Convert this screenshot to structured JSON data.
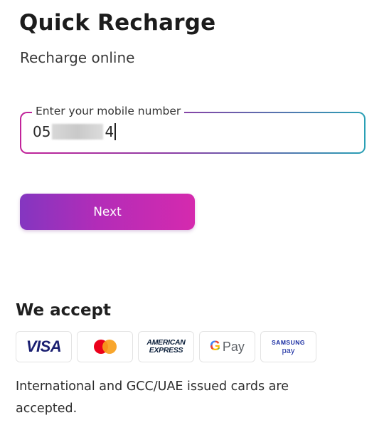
{
  "header": {
    "title": "Quick Recharge",
    "subtitle": "Recharge online"
  },
  "mobile_field": {
    "label": "Enter your mobile number",
    "value_prefix": "05",
    "value_suffix": "4"
  },
  "next_button": {
    "label": "Next"
  },
  "accept": {
    "heading": "We accept",
    "cards": [
      {
        "name": "VISA",
        "icon": "visa-logo"
      },
      {
        "name": "Mastercard",
        "icon": "mastercard-logo"
      },
      {
        "name_line1": "AMERICAN",
        "name_line2": "EXPRESS",
        "icon": "amex-logo"
      },
      {
        "g": "G",
        "name": "Pay",
        "icon": "google-pay-logo"
      },
      {
        "name_line1": "SAMSUNG",
        "name_line2": "pay",
        "icon": "samsung-pay-logo"
      }
    ],
    "note": "International and GCC/UAE issued cards are accepted."
  },
  "colors": {
    "gradient_start": "#8436c0",
    "gradient_end": "#d52aae",
    "field_border_end": "#2aa0b5",
    "visa_blue": "#1a1f71",
    "mc_red": "#eb001b",
    "mc_orange": "#f79e1b"
  }
}
